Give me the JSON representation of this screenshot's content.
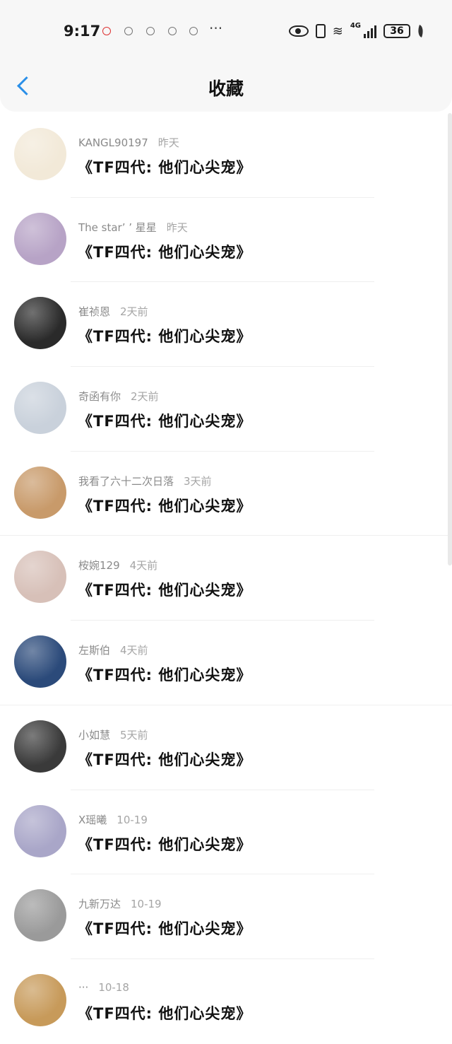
{
  "status": {
    "time": "9:17",
    "overflow": "···",
    "network": "4G",
    "battery": "36"
  },
  "header": {
    "title": "收藏",
    "back_icon": "chevron-left-icon",
    "accent": "#2a8fe8"
  },
  "favorites": [
    {
      "name": "KANGL90197",
      "time": "昨天",
      "title": "《TF四代: 他们心尖宠》",
      "avatar_color": "#f2e9d8"
    },
    {
      "name": "The star’ ’ 星星",
      "time": "昨天",
      "title": "《TF四代: 他们心尖宠》",
      "avatar_color": "#b7a3c6"
    },
    {
      "name": "崔祯恩",
      "time": "2天前",
      "title": "《TF四代: 他们心尖宠》",
      "avatar_color": "#2a2a2a"
    },
    {
      "name": "奇函有你",
      "time": "2天前",
      "title": "《TF四代: 他们心尖宠》",
      "avatar_color": "#c9d1db"
    },
    {
      "name": "我看了六十二次日落",
      "time": "3天前",
      "title": "《TF四代: 他们心尖宠》",
      "avatar_color": "#c89a6a"
    },
    {
      "name": "桉婉129",
      "time": "4天前",
      "title": "《TF四代: 他们心尖宠》",
      "avatar_color": "#d7c0b8"
    },
    {
      "name": "左斯伯",
      "time": "4天前",
      "title": "《TF四代: 他们心尖宠》",
      "avatar_color": "#2b4a7a"
    },
    {
      "name": "小如慧",
      "time": "5天前",
      "title": "《TF四代: 他们心尖宠》",
      "avatar_color": "#3a3a3a"
    },
    {
      "name": "X瑶曦",
      "time": "10-19",
      "title": "《TF四代: 他们心尖宠》",
      "avatar_color": "#a9a6c8"
    },
    {
      "name": "九新万达",
      "time": "10-19",
      "title": "《TF四代: 他们心尖宠》",
      "avatar_color": "#9a9a9a"
    },
    {
      "name": "···",
      "time": "10-18",
      "title": "《TF四代: 他们心尖宠》",
      "avatar_color": "#c79a5a"
    }
  ]
}
